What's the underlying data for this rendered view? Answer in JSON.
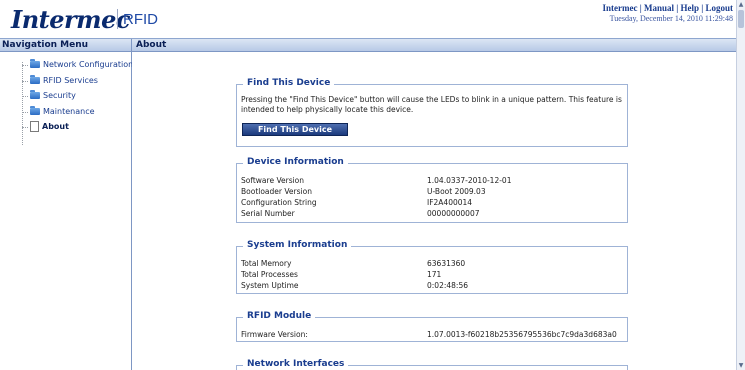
{
  "header": {
    "logo_text": "Intermec",
    "product": "RFID",
    "links": [
      "Intermec",
      "Manual",
      "Help",
      "Logout"
    ],
    "link_separator": " | ",
    "date": "Tuesday, December 14, 2010 11:29:48"
  },
  "sidebar": {
    "title": "Navigation Menu",
    "items": [
      {
        "label": "Network Configuration",
        "icon": "folder-icon"
      },
      {
        "label": "RFID Services",
        "icon": "folder-icon"
      },
      {
        "label": "Security",
        "icon": "folder-icon"
      },
      {
        "label": "Maintenance",
        "icon": "folder-icon"
      },
      {
        "label": "About",
        "icon": "page-icon",
        "active": true
      }
    ]
  },
  "main": {
    "title": "About",
    "find_device": {
      "legend": "Find This Device",
      "description": "Pressing the \"Find This Device\" button will cause the LEDs to blink in a unique pattern. This feature is intended to help physically locate this device.",
      "button_label": "Find This Device"
    },
    "device_information": {
      "legend": "Device Information",
      "rows": [
        {
          "key": "Software Version",
          "value": "1.04.0337-2010-12-01"
        },
        {
          "key": "Bootloader Version",
          "value": "U-Boot 2009.03"
        },
        {
          "key": "Configuration String",
          "value": "IF2A400014"
        },
        {
          "key": "Serial Number",
          "value": "00000000007"
        }
      ]
    },
    "system_information": {
      "legend": "System Information",
      "rows": [
        {
          "key": "Total Memory",
          "value": "63631360"
        },
        {
          "key": "Total Processes",
          "value": "171"
        },
        {
          "key": "System Uptime",
          "value": "0:02:48:56"
        }
      ]
    },
    "rfid_module": {
      "legend": "RFID Module",
      "rows": [
        {
          "key": "Firmware Version:",
          "value": "1.07.0013-f60218b25356795536bc7c9da3d683a0"
        }
      ]
    },
    "network_interfaces": {
      "legend": "Network Interfaces"
    }
  },
  "colors": {
    "brand": "#0a2a6e",
    "link": "#1a3d8f",
    "button": "#1b3a7d",
    "border": "#9fb3d6"
  }
}
